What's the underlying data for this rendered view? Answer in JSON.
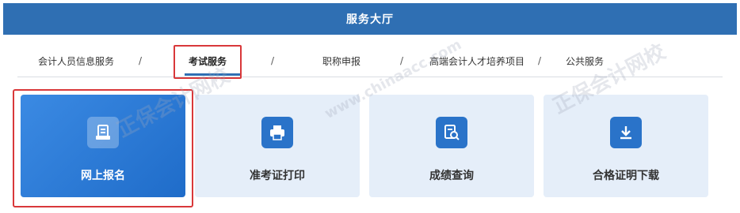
{
  "header": {
    "title": "服务大厅"
  },
  "nav": {
    "items": [
      {
        "label": "会计人员信息服务"
      },
      {
        "label": "考试服务"
      },
      {
        "label": "职称申报"
      },
      {
        "label": "高端会计人才培养项目"
      },
      {
        "label": "公共服务"
      }
    ],
    "separator": "/"
  },
  "cards": [
    {
      "label": "网上报名",
      "icon": "register-icon"
    },
    {
      "label": "准考证打印",
      "icon": "printer-icon"
    },
    {
      "label": "成绩查询",
      "icon": "search-document-icon"
    },
    {
      "label": "合格证明下载",
      "icon": "download-icon"
    }
  ],
  "watermark": {
    "text1": "正保会计网校",
    "text2": "www.chinaacc.com"
  },
  "colors": {
    "header_bg": "#2f6fb3",
    "highlight": "#d9383a",
    "card_bg": "#e5eef9",
    "card_primary": "#2a7bd6"
  }
}
